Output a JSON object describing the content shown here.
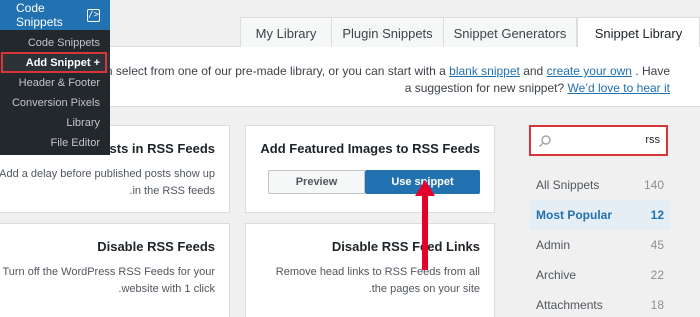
{
  "tabs": [
    "My Library",
    "Plugin Snippets",
    "Snippet Generators",
    "Snippet Library"
  ],
  "intro": {
    "part1": "can select from one of our pre-made library, or you can start with a",
    "blank_snippet": "blank snippet",
    "and": "and",
    "create_own": "create your own",
    "part2": ". Have a suggestion for new snippet?",
    "love_to_hear": "We’d love to hear it"
  },
  "sidebar": {
    "title": "Code Snippets",
    "items": [
      "Code Snippets",
      "Add Snippet +",
      "Header & Footer",
      "Conversion Pixels",
      "Library",
      "File Editor"
    ]
  },
  "cards": [
    {
      "title": "Posts in RSS Feeds",
      "desc": "Add a delay before published posts show up in the RSS feeds."
    },
    {
      "title": "Add Featured Images to RSS Feeds",
      "preview": "Preview",
      "use": "Use snippet"
    },
    {
      "title": "Disable RSS Feeds",
      "desc": "Turn off the WordPress RSS Feeds for your website with 1 click."
    },
    {
      "title": "Disable RSS Feed Links",
      "desc": "Remove head links to RSS Feeds from all the pages on your site."
    }
  ],
  "search": {
    "value": "rss"
  },
  "categories": [
    {
      "label": "All Snippets",
      "count": "140"
    },
    {
      "label": "Most Popular",
      "count": "12"
    },
    {
      "label": "Admin",
      "count": "45"
    },
    {
      "label": "Archive",
      "count": "22"
    },
    {
      "label": "Attachments",
      "count": "18"
    }
  ],
  "colors": {
    "accent": "#2271b1",
    "highlight": "#d63638",
    "sidebar": "#23282d"
  }
}
